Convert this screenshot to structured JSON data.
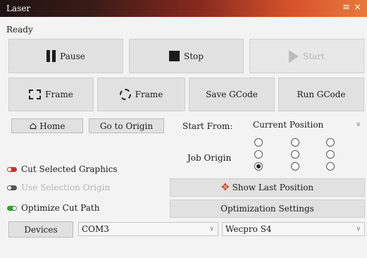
{
  "window": {
    "title": "Laser",
    "menu_icon": "hamburger-menu-icon",
    "close_icon": "close-icon",
    "accent_gradient": [
      "#1e1413",
      "#8a2a1e",
      "#e87a3c"
    ]
  },
  "status": {
    "text": "Ready"
  },
  "main_controls": {
    "pause_label": "Pause",
    "stop_label": "Stop",
    "start_label": "Start",
    "start_enabled": false
  },
  "frame_controls": {
    "frame_rect_label": "Frame",
    "frame_circle_label": "Frame",
    "save_gcode_label": "Save GCode",
    "run_gcode_label": "Run GCode"
  },
  "position_controls": {
    "home_label": "Home",
    "go_to_origin_label": "Go to Origin",
    "start_from_label": "Start From:",
    "start_from_value": "Current Position"
  },
  "job_origin": {
    "label": "Job Origin",
    "selected_row": 2,
    "selected_col": 0
  },
  "options": {
    "cut_selected_label": "Cut Selected Graphics",
    "cut_selected_on": false,
    "use_selection_origin_label": "Use Selection Origin",
    "use_selection_origin_on": false,
    "optimize_cut_path_label": "Optimize Cut Path",
    "optimize_cut_path_on": true,
    "toggle_on_color": "#3a9a3a",
    "toggle_off_color": "#c0392b",
    "toggle_disabled_color": "#555555"
  },
  "actions": {
    "show_last_position_label": "Show Last Position",
    "optimization_settings_label": "Optimization Settings"
  },
  "device": {
    "devices_label": "Devices",
    "port_value": "COM3",
    "machine_value": "Wecpro S4"
  }
}
